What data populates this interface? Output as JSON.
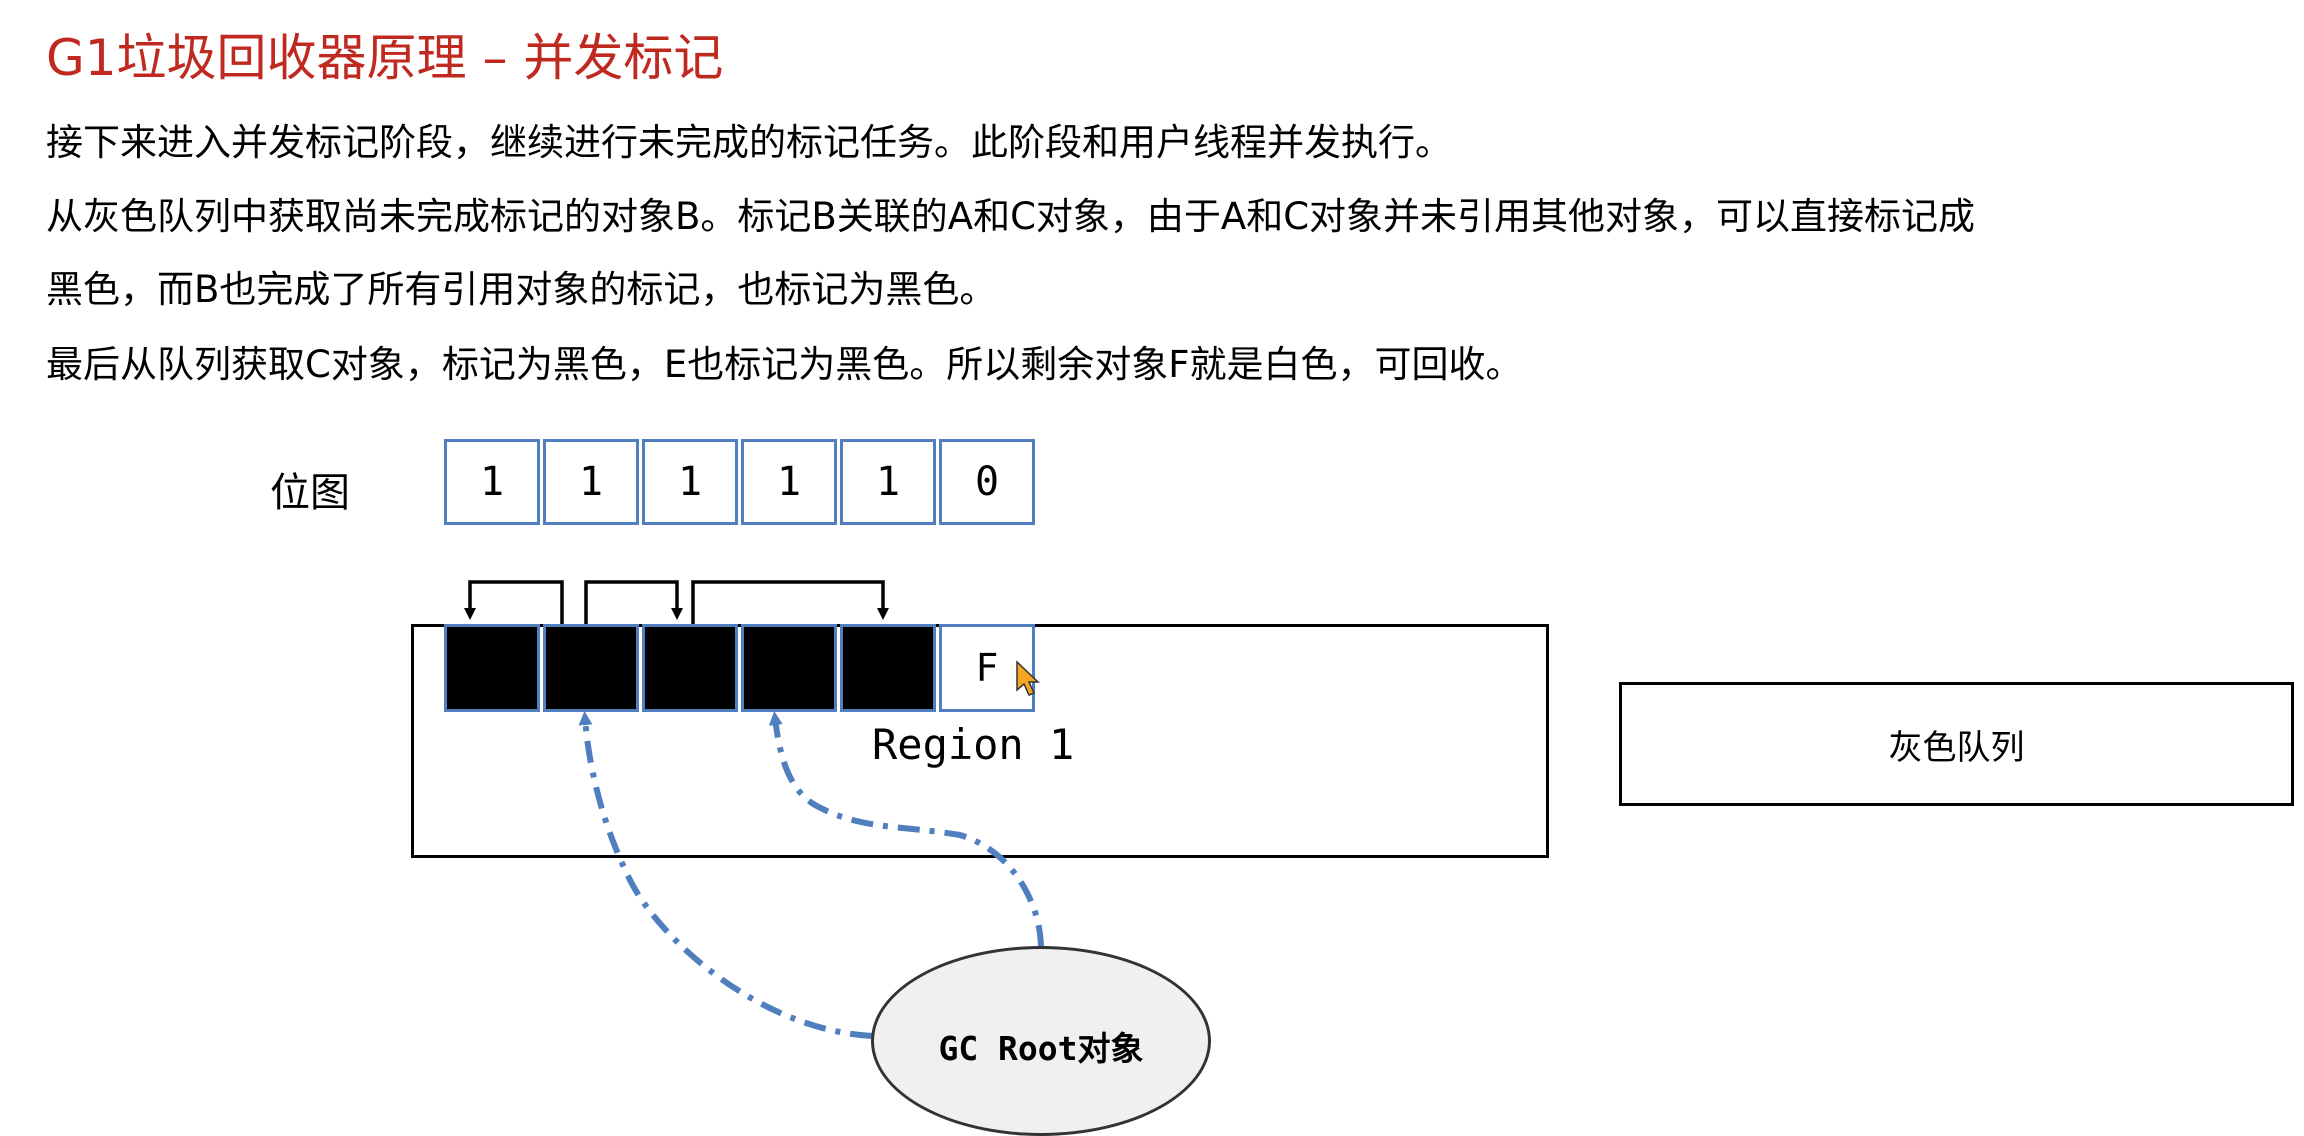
{
  "title": "G1垃圾回收器原理 – 并发标记",
  "paragraphs": [
    "接下来进入并发标记阶段，继续进行未完成的标记任务。此阶段和用户线程并发执行。",
    "从灰色队列中获取尚未完成标记的对象B。标记B关联的A和C对象，由于A和C对象并未引用其他对象，可以直接标记成",
    "黑色，而B也完成了所有引用对象的标记，也标记为黑色。",
    "最后从队列获取C对象，标记为黑色，E也标记为黑色。所以剩余对象F就是白色，可回收。"
  ],
  "bitmap": {
    "label": "位图",
    "bits": [
      "1",
      "1",
      "1",
      "1",
      "1",
      "0"
    ]
  },
  "region": {
    "label": "Region 1",
    "cells": [
      {
        "text": "",
        "color": "black"
      },
      {
        "text": "",
        "color": "black"
      },
      {
        "text": "",
        "color": "black"
      },
      {
        "text": "",
        "color": "black"
      },
      {
        "text": "",
        "color": "black"
      },
      {
        "text": "F",
        "color": "white"
      }
    ]
  },
  "gray_queue": {
    "label": "灰色队列"
  },
  "gc_root": {
    "label": "GC Root对象"
  },
  "colors": {
    "title": "#c0291f",
    "cell_border": "#4f7fbe",
    "root_link": "#4f7fbe"
  }
}
